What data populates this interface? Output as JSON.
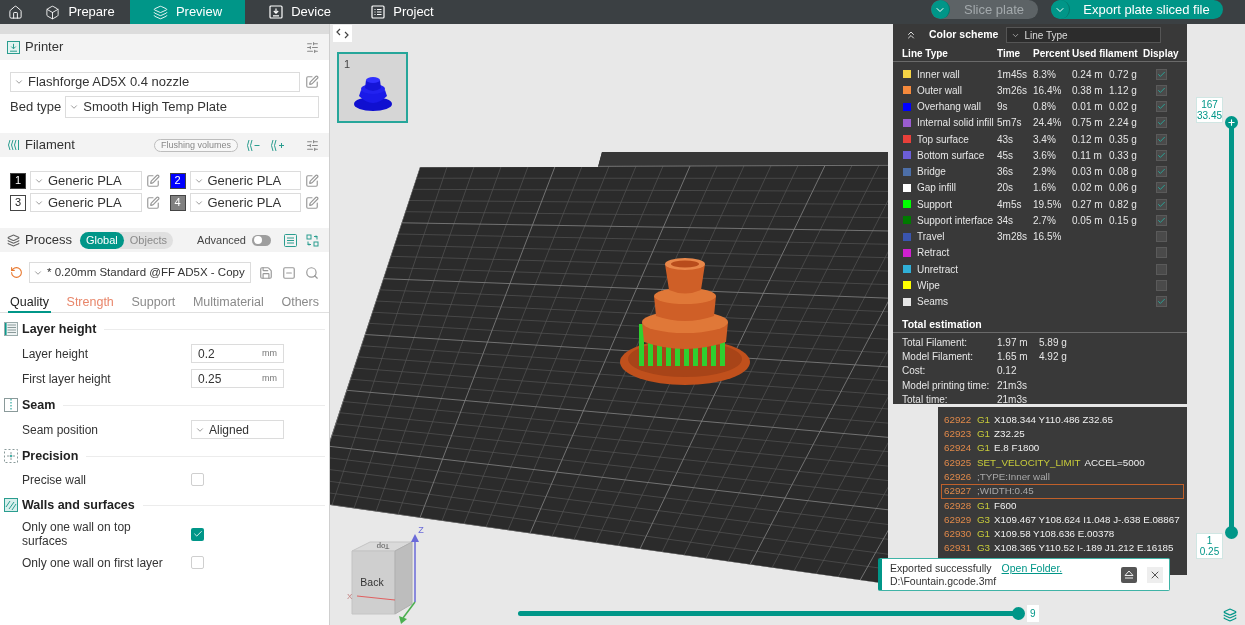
{
  "top_bar": {
    "tabs": [
      {
        "label": "Prepare",
        "selected": false
      },
      {
        "label": "Preview",
        "selected": true
      },
      {
        "label": "Device",
        "selected": false
      },
      {
        "label": "Project",
        "selected": false
      }
    ],
    "buttons": [
      {
        "label": "Slice plate",
        "disabled": true
      },
      {
        "label": "Export plate sliced file",
        "disabled": false
      }
    ]
  },
  "printer": {
    "title": "Printer",
    "preset": "Flashforge AD5X 0.4 nozzle",
    "bed_type_label": "Bed type",
    "bed_type": "Smooth High Temp Plate"
  },
  "filament": {
    "title": "Filament",
    "flushing_button": "Flushing volumes",
    "slots": [
      {
        "number": "1",
        "color": "#000000",
        "name": "Generic PLA"
      },
      {
        "number": "2",
        "color": "#0000ff",
        "name": "Generic PLA"
      },
      {
        "number": "3",
        "color": "#ffffff",
        "name": "Generic PLA"
      },
      {
        "number": "4",
        "color": "#808080",
        "name": "Generic PLA"
      }
    ]
  },
  "process": {
    "title": "Process",
    "scopes": [
      {
        "label": "Global",
        "selected": true
      },
      {
        "label": "Objects",
        "selected": false
      }
    ],
    "advanced": {
      "label": "Advanced",
      "on": false
    },
    "preset": "* 0.20mm Standard @FF AD5X - Copy",
    "tabs": [
      {
        "label": "Quality",
        "selected": true,
        "modified": false
      },
      {
        "label": "Strength",
        "selected": false,
        "modified": true
      },
      {
        "label": "Support",
        "selected": false,
        "modified": false
      },
      {
        "label": "Multimaterial",
        "selected": false,
        "modified": false
      },
      {
        "label": "Others",
        "selected": false,
        "modified": false
      }
    ],
    "groups": [
      {
        "kind": "layers",
        "title": "Layer height",
        "settings": [
          {
            "kind": "number",
            "label": "Layer height",
            "value": "0.2",
            "unit": "mm"
          },
          {
            "kind": "number",
            "label": "First layer height",
            "value": "0.25",
            "unit": "mm"
          }
        ]
      },
      {
        "kind": "seam",
        "title": "Seam",
        "settings": [
          {
            "kind": "select",
            "label": "Seam position",
            "value": "Aligned"
          }
        ]
      },
      {
        "kind": "precision",
        "title": "Precision",
        "settings": [
          {
            "kind": "checkbox",
            "label": "Precise wall",
            "checked": false
          }
        ]
      },
      {
        "kind": "walls",
        "title": "Walls and surfaces",
        "settings": [
          {
            "kind": "checkbox",
            "label": "Only one wall on top surfaces",
            "checked": true
          },
          {
            "kind": "checkbox",
            "label": "Only one wall on first layer",
            "checked": false
          }
        ]
      }
    ]
  },
  "plate": {
    "number": "1",
    "selected": true
  },
  "color_scheme": {
    "title": "Color scheme",
    "mode": "Line Type",
    "columns": [
      "Line Type",
      "Time",
      "Percent",
      "Used filament",
      "Display"
    ],
    "rows": [
      {
        "name": "Inner wall",
        "color": "#f5d445",
        "time": "1m45s",
        "percent": "8.3%",
        "length": "0.24 m",
        "weight": "0.72 g",
        "display": true
      },
      {
        "name": "Outer wall",
        "color": "#f58a3c",
        "time": "3m26s",
        "percent": "16.4%",
        "length": "0.38 m",
        "weight": "1.12 g",
        "display": true
      },
      {
        "name": "Overhang wall",
        "color": "#0000ff",
        "time": "9s",
        "percent": "0.8%",
        "length": "0.01 m",
        "weight": "0.02 g",
        "display": true
      },
      {
        "name": "Internal solid infill",
        "color": "#9a5cd0",
        "time": "5m7s",
        "percent": "24.4%",
        "length": "0.75 m",
        "weight": "2.24 g",
        "display": true
      },
      {
        "name": "Top surface",
        "color": "#e8403a",
        "time": "43s",
        "percent": "3.4%",
        "length": "0.12 m",
        "weight": "0.35 g",
        "display": true
      },
      {
        "name": "Bottom surface",
        "color": "#6c5ed8",
        "time": "45s",
        "percent": "3.6%",
        "length": "0.11 m",
        "weight": "0.33 g",
        "display": true
      },
      {
        "name": "Bridge",
        "color": "#4d6fa8",
        "time": "36s",
        "percent": "2.9%",
        "length": "0.03 m",
        "weight": "0.08 g",
        "display": true
      },
      {
        "name": "Gap infill",
        "color": "#ffffff",
        "time": "20s",
        "percent": "1.6%",
        "length": "0.02 m",
        "weight": "0.06 g",
        "display": true
      },
      {
        "name": "Support",
        "color": "#00ff00",
        "time": "4m5s",
        "percent": "19.5%",
        "length": "0.27 m",
        "weight": "0.82 g",
        "display": true
      },
      {
        "name": "Support interface",
        "color": "#007a00",
        "time": "34s",
        "percent": "2.7%",
        "length": "0.05 m",
        "weight": "0.15 g",
        "display": true
      },
      {
        "name": "Travel",
        "color": "#3a55b0",
        "time": "3m28s",
        "percent": "16.5%",
        "display": false
      },
      {
        "name": "Retract",
        "color": "#d020d0",
        "display": false
      },
      {
        "name": "Unretract",
        "color": "#30b0d8",
        "display": false
      },
      {
        "name": "Wipe",
        "color": "#ffff00",
        "display": false
      },
      {
        "name": "Seams",
        "color": "#e6e6e6",
        "display": true
      }
    ],
    "total": {
      "title": "Total estimation",
      "rows": [
        {
          "label": "Total Filament:",
          "values": [
            "1.97 m",
            "5.89 g"
          ]
        },
        {
          "label": "Model Filament:",
          "values": [
            "1.65 m",
            "4.92 g"
          ]
        },
        {
          "label": "Cost:",
          "values": [
            "0.12"
          ]
        },
        {
          "label": "Model printing time:",
          "values": [
            "21m3s"
          ]
        },
        {
          "label": "Total time:",
          "values": [
            "21m3s"
          ]
        }
      ]
    }
  },
  "gcode": {
    "lines": [
      {
        "kind": "command",
        "number": "62922",
        "command": "G1",
        "args": "X108.344 Y110.486 Z32.65",
        "selected": false
      },
      {
        "kind": "command",
        "number": "62923",
        "command": "G1",
        "args": "Z32.25",
        "selected": false
      },
      {
        "kind": "command",
        "number": "62924",
        "command": "G1",
        "args": "E.8 F1800",
        "selected": false
      },
      {
        "kind": "command",
        "number": "62925",
        "command": "SET_VELOCITY_LIMIT",
        "args": "ACCEL=5000",
        "selected": false
      },
      {
        "kind": "comment",
        "number": "62926",
        "text": ";TYPE:Inner wall",
        "selected": false
      },
      {
        "kind": "comment",
        "number": "62927",
        "text": ";WIDTH:0.45",
        "selected": true
      },
      {
        "kind": "command",
        "number": "62928",
        "command": "G1",
        "args": "F600",
        "selected": false
      },
      {
        "kind": "command",
        "number": "62929",
        "command": "G3",
        "args": "X109.467 Y108.624 I1.048 J-.638 E.08867",
        "selected": false
      },
      {
        "kind": "command",
        "number": "62930",
        "command": "G1",
        "args": "X109.58 Y108.636 E.00378",
        "selected": false
      },
      {
        "kind": "command",
        "number": "62931",
        "command": "G3",
        "args": "X108.365 Y110.52 I-.189 J1.212 E.16185",
        "selected": false
      }
    ]
  },
  "layer_slider": {
    "thumbs": [
      {
        "labels": [
          "167",
          "33.45"
        ],
        "level": 1
      },
      {
        "labels": [
          "1",
          "0.25"
        ],
        "level": 0
      }
    ]
  },
  "move_slider": {
    "label": "9",
    "level": 1
  },
  "notification": {
    "message": "Exported successfully",
    "link": "Open Folder.",
    "path": "D:\\Fountain.gcode.3mf"
  },
  "view_cube": {
    "faces": [
      "Top",
      "Back"
    ],
    "axes": [
      "Z",
      "X"
    ]
  }
}
